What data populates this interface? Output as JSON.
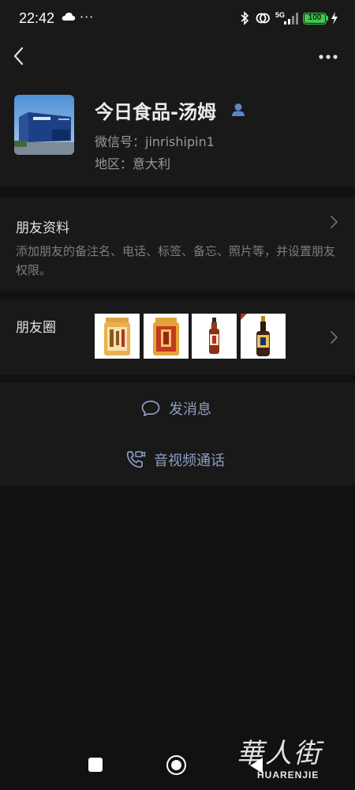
{
  "status_bar": {
    "time": "22:42",
    "network": "5G",
    "battery": "100",
    "icons": [
      "cloud-icon",
      "more-dots-icon",
      "bluetooth-icon",
      "link-icon",
      "signal-icon",
      "battery-icon",
      "charging-icon"
    ]
  },
  "header": {
    "icons": [
      "back-arrow-icon",
      "more-options-icon"
    ]
  },
  "profile": {
    "name": "今日食品-汤姆",
    "wechat_id": "微信号：jinrishipin1",
    "region": "地区：意大利",
    "gender_icon": "male-icon"
  },
  "friend_info": {
    "title": "朋友资料",
    "description": "添加朋友的备注名、电话、标签、备忘、照片等，并设置朋友权限。"
  },
  "moments": {
    "title": "朋友圈",
    "thumbnails": [
      "jar-product-1",
      "jar-product-2",
      "sauce-bottle-small",
      "vinegar-bottle"
    ]
  },
  "actions": {
    "send_message": "发消息",
    "av_call": "音视频通话"
  },
  "bottom_nav": {
    "icons": [
      "recents-square-icon",
      "home-circle-icon",
      "back-triangle-icon"
    ]
  },
  "watermark": {
    "chinese": "華人街",
    "english": "HUARENJIE"
  },
  "colors": {
    "background": "#111111",
    "panel": "#191919",
    "link_blue": "#8c9fc2",
    "battery_green": "#3fc94f"
  }
}
